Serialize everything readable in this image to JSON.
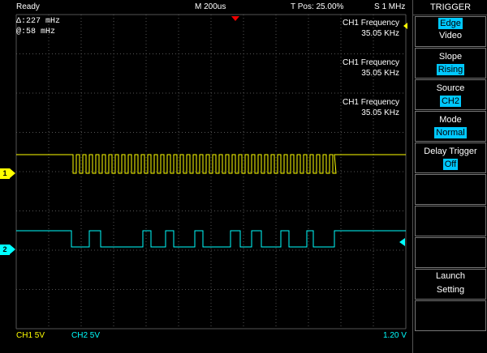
{
  "topbar": {
    "status": "Ready",
    "timebase": "M 200us",
    "trigger_position": "T Pos: 25.00%",
    "sample_rate": "S 1 MHz"
  },
  "cursors": {
    "delta": "Δ:227 mHz",
    "at": "@:58 mHz"
  },
  "measurements": [
    {
      "label": "CH1 Frequency",
      "value": "35.05 KHz"
    },
    {
      "label": "CH1 Frequency",
      "value": "35.05 KHz"
    },
    {
      "label": "CH1 Frequency",
      "value": "35.05 KHz"
    }
  ],
  "channels": {
    "ch1": {
      "marker": "1",
      "color": "#ffff00",
      "scale": "CH1  5V"
    },
    "ch2": {
      "marker": "2",
      "color": "#00ffff",
      "scale": "CH2  5V"
    }
  },
  "trigger_level": "1.20 V",
  "menu": {
    "title": "TRIGGER",
    "items": [
      {
        "label": "Edge",
        "value": "Video"
      },
      {
        "label": "Slope",
        "value": "Rising"
      },
      {
        "label": "Source",
        "value": "CH2"
      },
      {
        "label": "Mode",
        "value": "Normal"
      },
      {
        "label": "Delay Trigger",
        "value": "Off"
      },
      {
        "label": "",
        "value": ""
      },
      {
        "label": "",
        "value": ""
      },
      {
        "label": "Launch",
        "value": "Setting"
      },
      {
        "label": "",
        "value": ""
      }
    ]
  },
  "colors": {
    "grid": "#555555",
    "menu_highlight": "#00c8ff",
    "trigger_pointer": "#ee0000"
  }
}
